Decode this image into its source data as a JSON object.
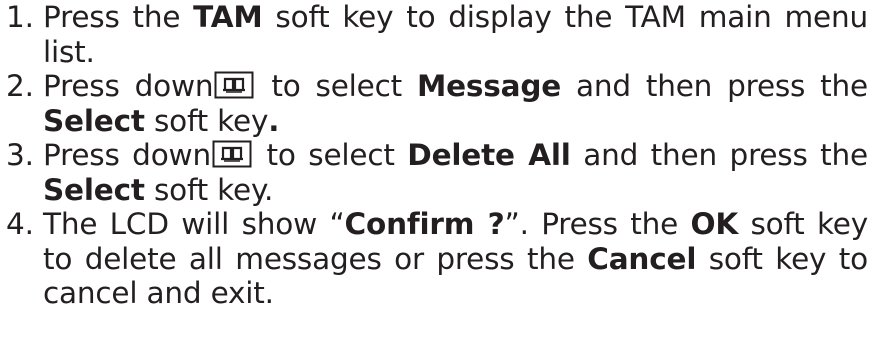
{
  "steps": [
    {
      "number": "1.",
      "line1": {
        "a": "Press the ",
        "b": "TAM",
        "c": " soft key to display the TAM main menu"
      },
      "line2": {
        "a": "list."
      }
    },
    {
      "number": "2.",
      "line1": {
        "a": "Press down",
        "icon": "phonebook-key-icon",
        "b": " to select ",
        "c": "Message",
        "d": " and then press the"
      },
      "line2": {
        "a": "Select",
        "b": " soft key",
        "c": "."
      }
    },
    {
      "number": "3.",
      "line1": {
        "a": "Press down",
        "icon": "phonebook-key-icon",
        "b": " to select ",
        "c": "Delete All",
        "d": " and then press the"
      },
      "line2": {
        "a": "Select",
        "b": " soft key."
      }
    },
    {
      "number": "4.",
      "line1": {
        "a": "The LCD will show “",
        "b": "Confirm ?",
        "c": "”.  Press the ",
        "d": "OK",
        "e": " soft key"
      },
      "line2": {
        "a": "to delete all messages or press the ",
        "b": "Cancel",
        "c": " soft key to"
      },
      "line3": {
        "a": "cancel and exit."
      }
    }
  ],
  "colors": {
    "text": "#231f20",
    "background": "#ffffff"
  }
}
